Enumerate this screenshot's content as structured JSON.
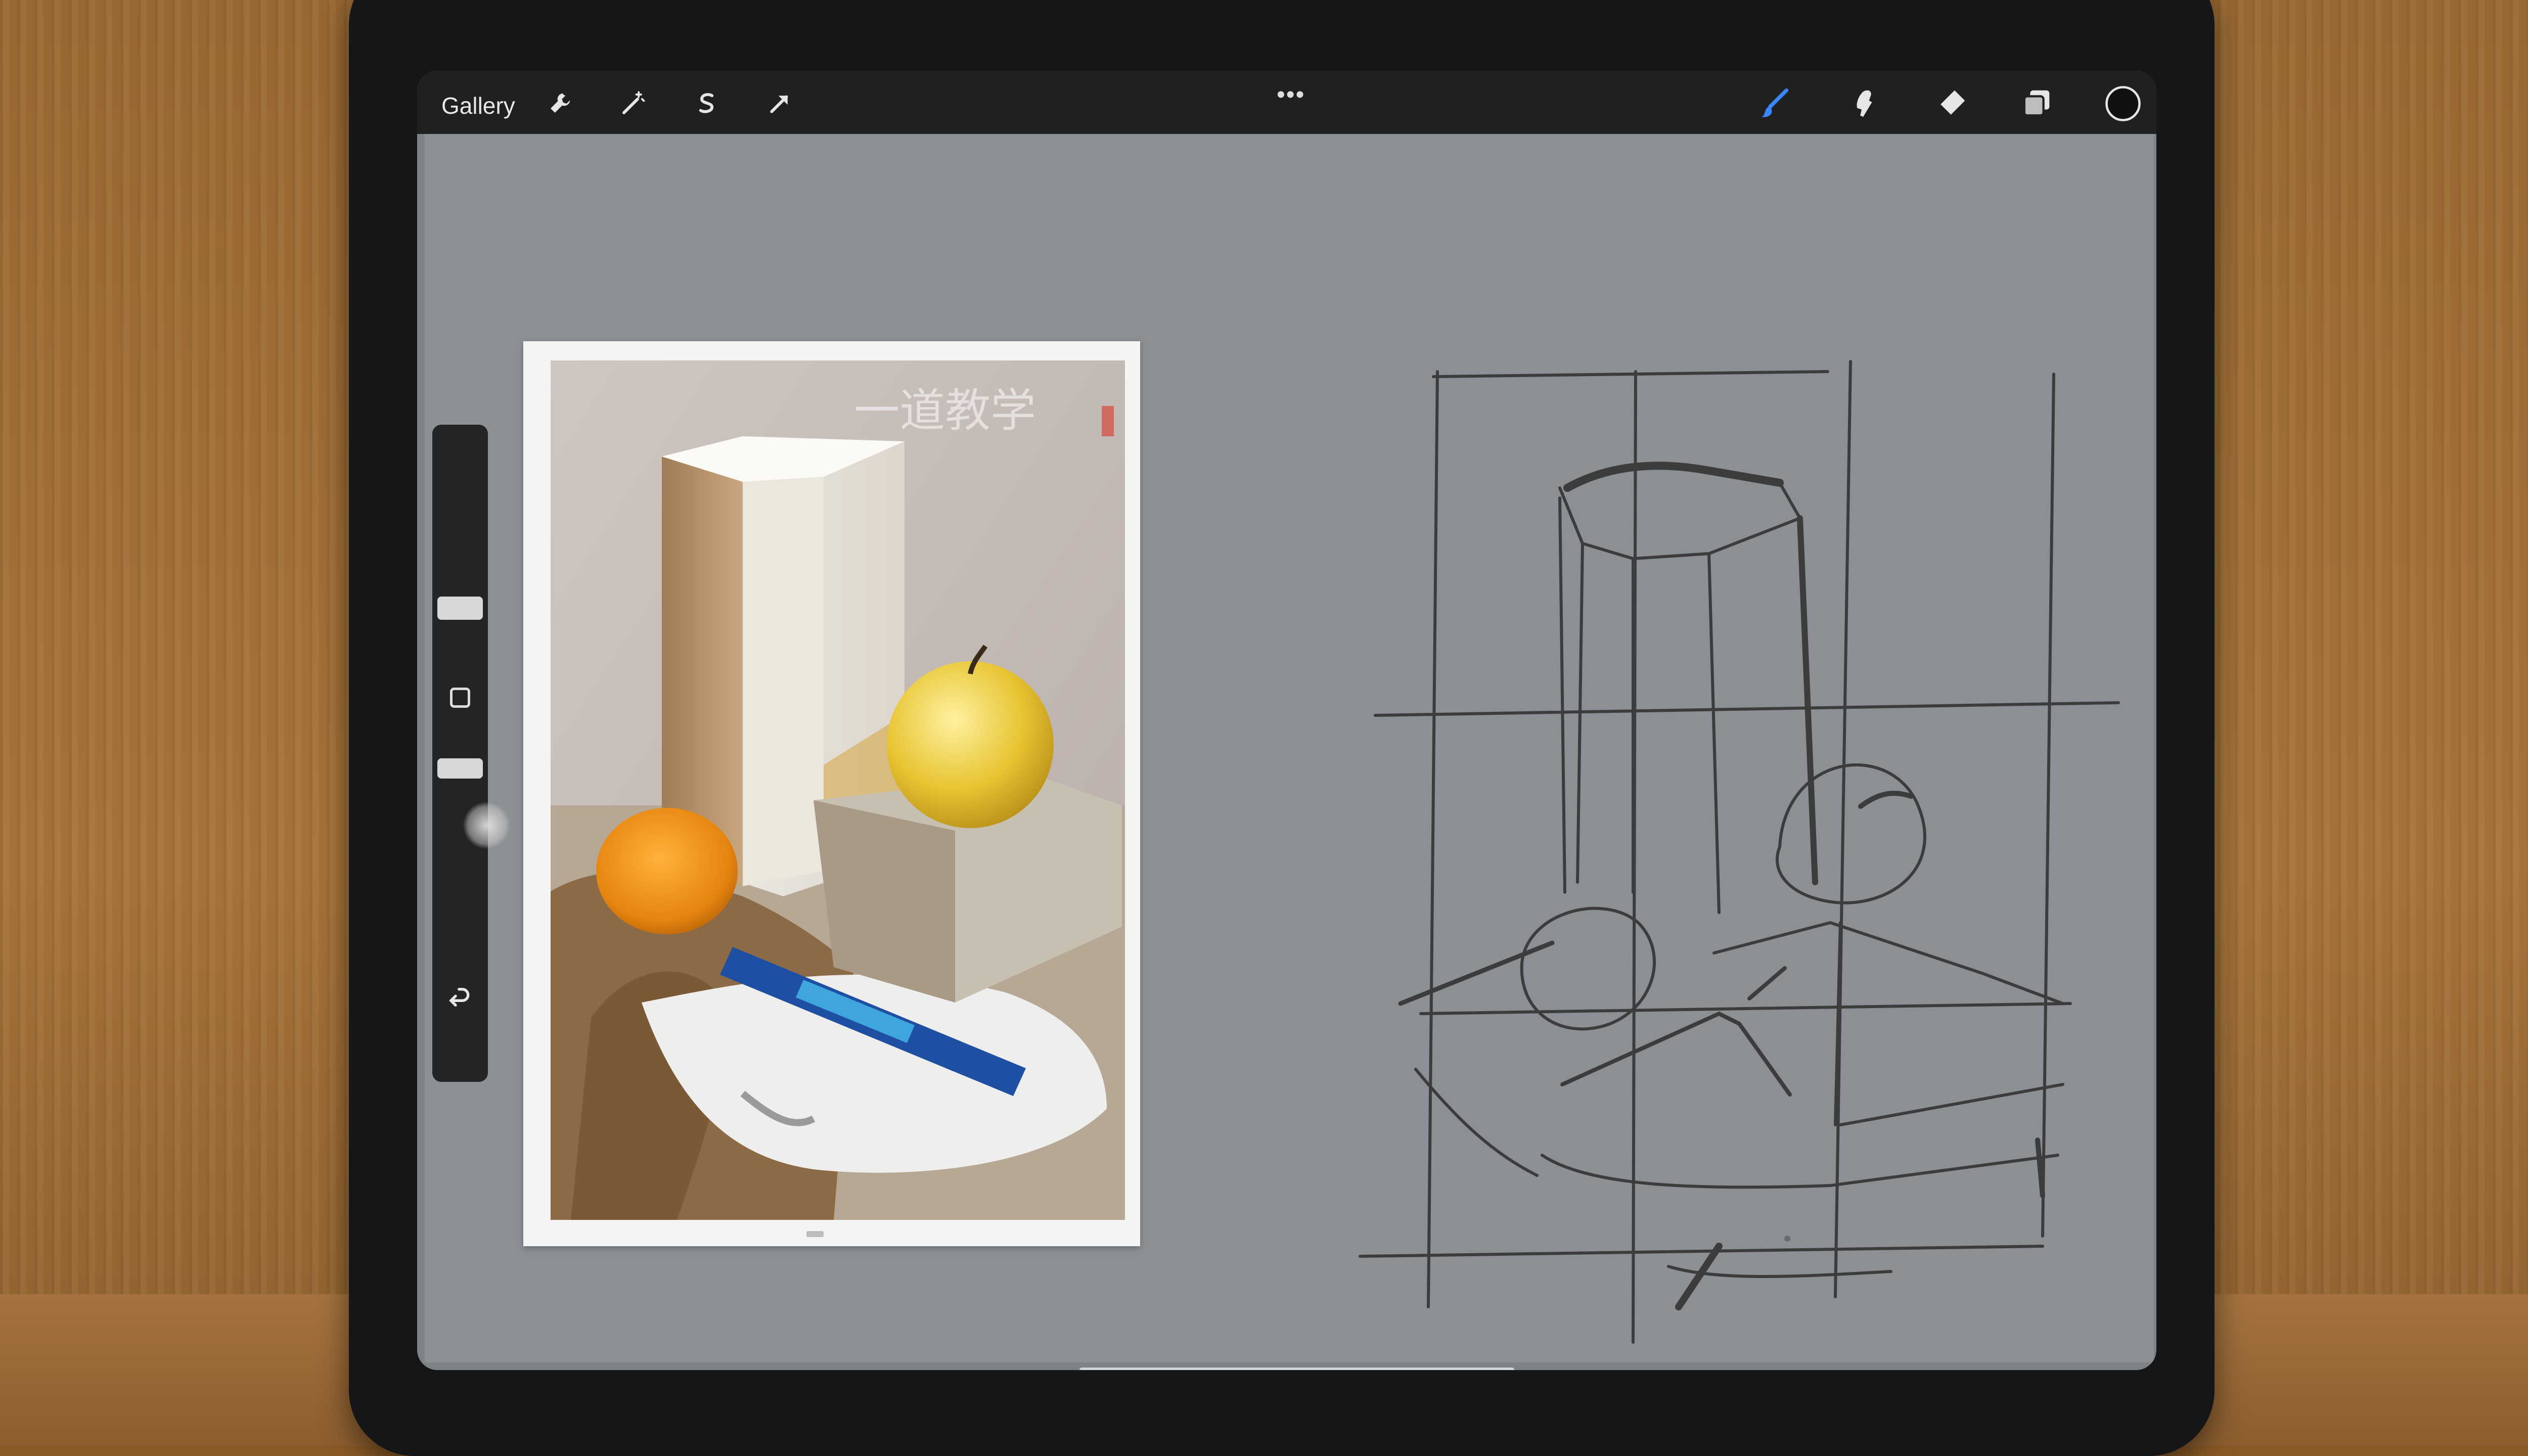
{
  "app": {
    "toolbar": {
      "gallery_label": "Gallery",
      "more_label": "•••",
      "icons": [
        "wrench-icon",
        "magic-wand-icon",
        "selection-icon",
        "move-arrow-icon",
        "brush-icon",
        "smudge-icon",
        "eraser-icon",
        "layers-icon",
        "color-circle-icon"
      ],
      "active_tool": "brush",
      "accent_color": "#3a86ff"
    },
    "sidebar": {
      "controls": [
        "brush-size-slider",
        "modify-button",
        "opacity-slider",
        "undo-button"
      ]
    }
  },
  "canvas": {
    "background_color": "#8c8f93",
    "reference_photo": {
      "watermark_text": "一道教学",
      "subjects": [
        "octagonal-plaster-prism",
        "yellow-apple",
        "orange",
        "stone-block",
        "blue-marker",
        "draped-cloth"
      ]
    },
    "sketch": {
      "grid": "3x3 construction grid",
      "stroke_color": "#3c3c3c"
    }
  }
}
